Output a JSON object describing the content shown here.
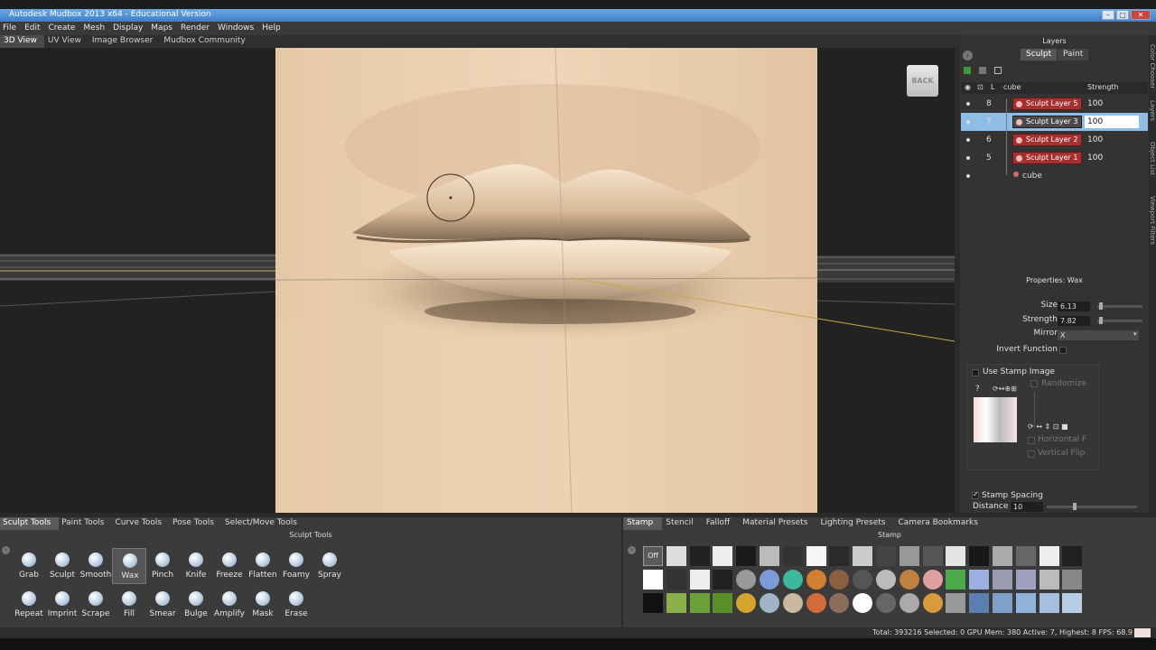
{
  "window": {
    "title": "Autodesk Mudbox 2013 x64 - Educational Version"
  },
  "menu": [
    "File",
    "Edit",
    "Create",
    "Mesh",
    "Display",
    "Maps",
    "Render",
    "Windows",
    "Help"
  ],
  "view_tabs": [
    {
      "label": "3D View",
      "active": true
    },
    {
      "label": "UV View",
      "active": false
    },
    {
      "label": "Image Browser",
      "active": false
    },
    {
      "label": "Mudbox Community",
      "active": false
    }
  ],
  "viewport": {
    "back_label": "BACK"
  },
  "layers_panel": {
    "title": "Layers",
    "modes": [
      {
        "label": "Sculpt",
        "active": true
      },
      {
        "label": "Paint",
        "active": false
      }
    ],
    "columns": {
      "l": "L",
      "name": "cube",
      "strength": "Strength"
    },
    "rows": [
      {
        "num": "8",
        "name": "Sculpt Layer 5",
        "strength": "100",
        "selected": false
      },
      {
        "num": "7",
        "name": "Sculpt Layer 3",
        "strength": "100",
        "selected": true
      },
      {
        "num": "6",
        "name": "Sculpt Layer 2",
        "strength": "100",
        "selected": false
      },
      {
        "num": "5",
        "name": "Sculpt Layer 1",
        "strength": "100",
        "selected": false
      }
    ],
    "base": "cube"
  },
  "side_tabs": [
    "Color Chooser",
    "Layers",
    "Object List",
    "Viewport Filters"
  ],
  "properties": {
    "title": "Properties: Wax",
    "size_label": "Size",
    "size_value": "6.13",
    "size_level": 0.05,
    "strength_label": "Strength",
    "strength_value": "7.82",
    "strength_level": 0.05,
    "mirror_label": "Mirror",
    "mirror_value": "X",
    "invert_label": "Invert Function",
    "use_stamp_label": "Use Stamp Image",
    "randomize_label": "Randomize",
    "hflip_label": "Horizontal F",
    "vflip_label": "Vertical Flip",
    "stamp_spacing_label": "Stamp Spacing",
    "distance_label": "Distance",
    "distance_value": "10",
    "distance_level": 0.3
  },
  "bottom_tabs": [
    {
      "label": "Sculpt Tools",
      "active": true
    },
    {
      "label": "Paint Tools",
      "active": false
    },
    {
      "label": "Curve Tools",
      "active": false
    },
    {
      "label": "Pose Tools",
      "active": false
    },
    {
      "label": "Select/Move Tools",
      "active": false
    }
  ],
  "sculpt_tray": {
    "title": "Sculpt Tools",
    "row1": [
      "Grab",
      "Sculpt",
      "Smooth",
      "Wax",
      "Pinch",
      "Knife",
      "Freeze",
      "Flatten",
      "Foamy",
      "Spray"
    ],
    "row2": [
      "Repeat",
      "Imprint",
      "Scrape",
      "Fill",
      "Smear",
      "Bulge",
      "Amplify",
      "Mask",
      "Erase"
    ],
    "active": "Wax"
  },
  "stamp_tabs": [
    {
      "label": "Stamp",
      "active": true
    },
    {
      "label": "Stencil",
      "active": false
    },
    {
      "label": "Falloff",
      "active": false
    },
    {
      "label": "Material Presets",
      "active": false
    },
    {
      "label": "Lighting Presets",
      "active": false
    },
    {
      "label": "Camera Bookmarks",
      "active": false
    }
  ],
  "stamp_tray": {
    "title": "Stamp",
    "off_label": "Off"
  },
  "status": {
    "text": "Total: 393216  Selected: 0 GPU Mem: 380  Active: 7, Highest: 8  FPS: 68.9"
  }
}
